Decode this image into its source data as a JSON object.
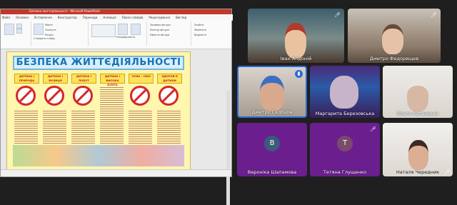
{
  "window": {
    "title": "Безпека життєдіяльності - Microsoft PowerPoint",
    "tabs": [
      "Файл",
      "Основне",
      "Вставлення",
      "Конструктор",
      "Переходи",
      "Анімація",
      "Показ слайдів",
      "Рецензування",
      "Вигляд"
    ]
  },
  "ribbon": {
    "labels": [
      "Створити слайд",
      "Макет",
      "Скинути",
      "Розділ",
      "Упорядкувати",
      "Швидкі стилі",
      "Заливка фігури",
      "Контур фігури",
      "Ефекти фігури",
      "Знайти",
      "Замінити",
      "Виділити"
    ]
  },
  "slide": {
    "title": "БЕЗПЕКА ЖИТТЄДІЯЛЬНОСТІ",
    "categories": [
      "ДИТИНА І ПРИРОДА",
      "ДИТИНА І ВУЛИЦЯ",
      "ДИТИНА І ПОБУТ",
      "ДИТИНА І ВИСОКА БІЛІТА",
      "ЧУЖІ - СВОЇ",
      "ЗДОРОВ'Я ДИТИНИ"
    ]
  },
  "participants": [
    {
      "name": "Іван Алдоній",
      "muted": true,
      "type": "video"
    },
    {
      "name": "Дмитро Федорищев",
      "muted": true,
      "type": "video"
    },
    {
      "name": "Дмитро Скобцов",
      "muted": false,
      "type": "video",
      "speaking": true
    },
    {
      "name": "Маргарита Березовська",
      "muted": false,
      "type": "video"
    },
    {
      "name": "Ольга Катанська",
      "muted": false,
      "type": "video"
    },
    {
      "name": "Вероніка Шапамова",
      "muted": true,
      "type": "avatar",
      "initial": "В"
    },
    {
      "name": "Тетяна Глущенко",
      "muted": true,
      "type": "avatar",
      "initial": "Т"
    },
    {
      "name": "Наталя Чередник",
      "muted": true,
      "type": "video"
    }
  ],
  "colors": {
    "avatar_bg": "#6b1f8f",
    "speaking": "#2b6cd8",
    "title_bar": "#c0392b"
  }
}
